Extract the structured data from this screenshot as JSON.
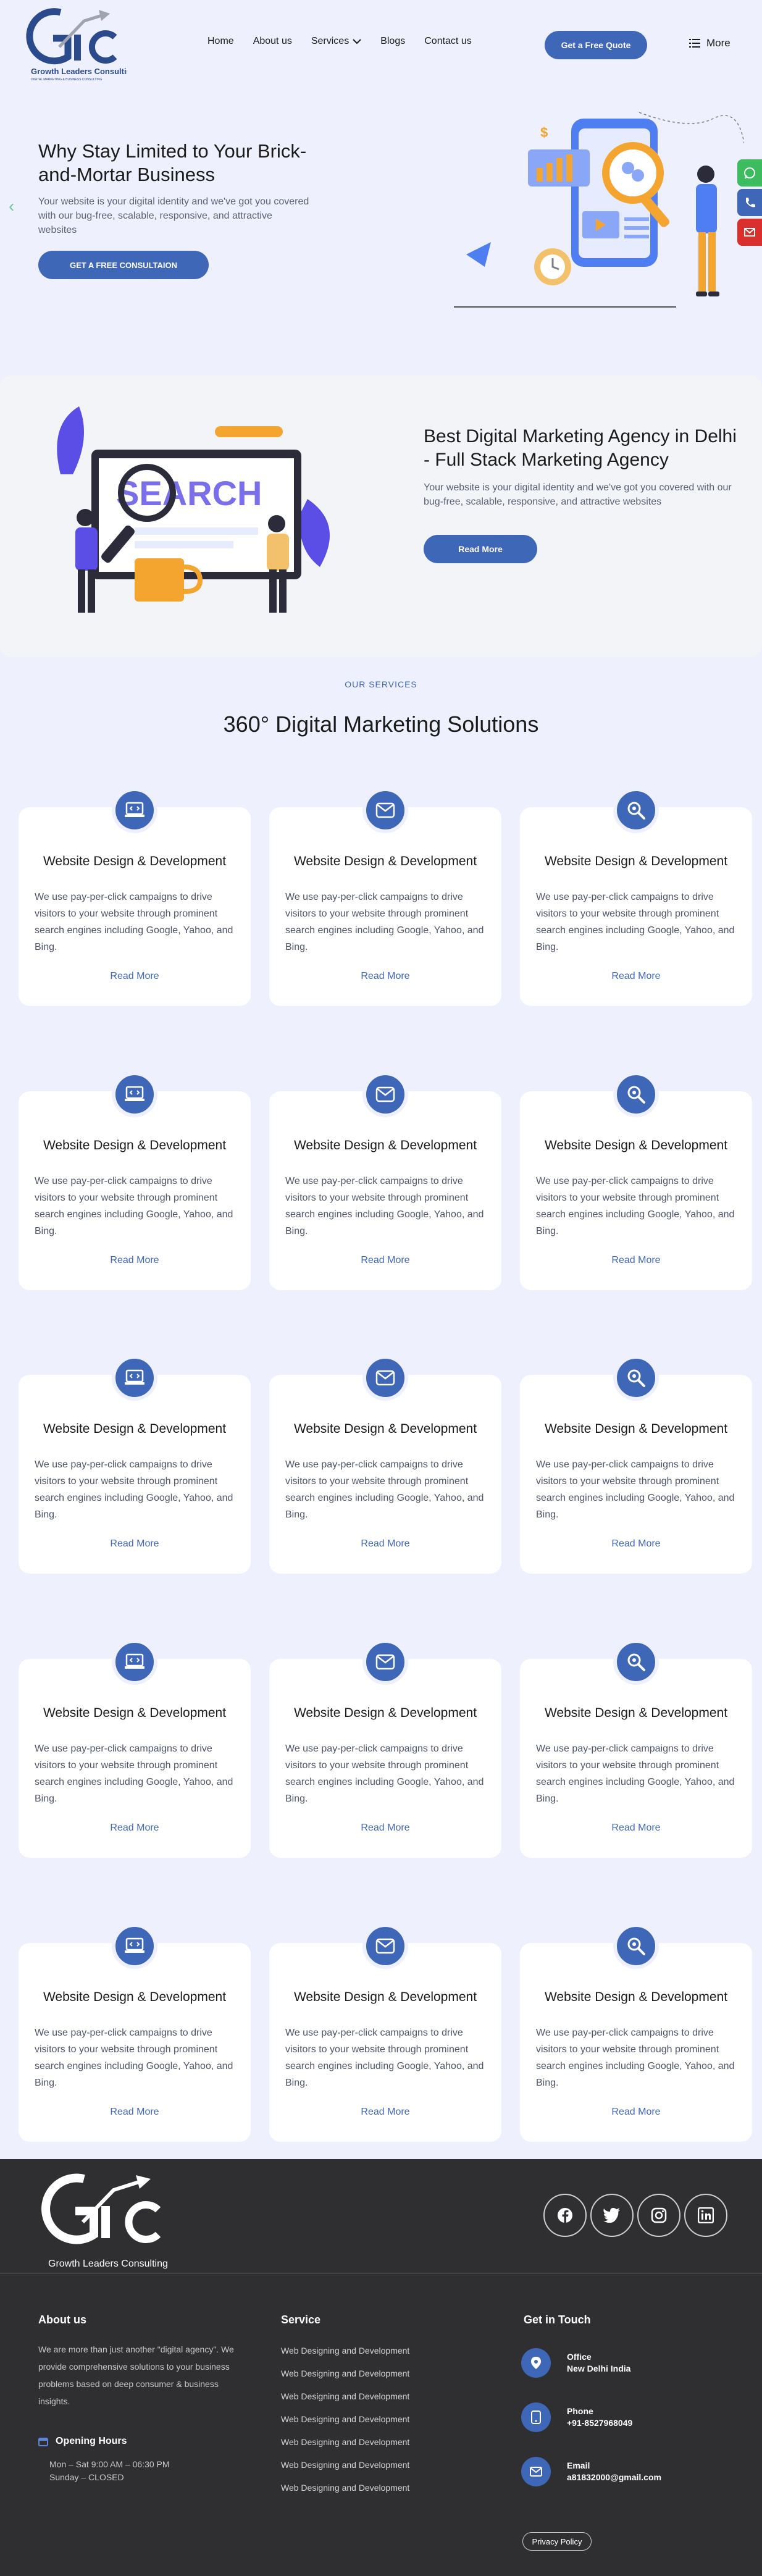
{
  "brand": {
    "logo_text": "Growth Leaders Consulting",
    "logo_tagline": "DIGITAL MARKETING & BUSINESS CONSULTING"
  },
  "nav": {
    "items": [
      {
        "label": "Home"
      },
      {
        "label": "About us"
      },
      {
        "label": "Services"
      },
      {
        "label": "Blogs"
      },
      {
        "label": "Contact us"
      }
    ],
    "quote_button": "Get a Free Quote",
    "more_label": "More"
  },
  "hero": {
    "title": "Why Stay Limited to Your Brick-and-Mortar Business",
    "text": "Your website is your digital identity and we've got you covered with our bug-free, scalable, responsive, and attractive websites",
    "button": "GET A FREE CONSULTAION"
  },
  "agency": {
    "title": "Best Digital Marketing Agency in Delhi - Full Stack Marketing Agency",
    "text": "Your website is your digital identity and we've got you covered with our bug-free, scalable, responsive, and attractive websites",
    "button": "Read More",
    "art_word": "SEARCH"
  },
  "services": {
    "eyebrow": "OUR SERVICES",
    "title": "360° Digital Marketing Solutions",
    "cards": [
      {
        "icon": "laptop-code-icon",
        "title": "Website Design & Development",
        "text": "We use pay-per-click campaigns to drive visitors to your website through prominent search engines including Google, Yahoo, and Bing.",
        "link": "Read More"
      },
      {
        "icon": "envelope-icon",
        "title": "Website Design & Development",
        "text": "We use pay-per-click campaigns to drive visitors to your website through prominent search engines including Google, Yahoo, and Bing.",
        "link": "Read More"
      },
      {
        "icon": "search-icon",
        "title": "Website Design & Development",
        "text": "We use pay-per-click campaigns to drive visitors to your website through prominent search engines including Google, Yahoo, and Bing.",
        "link": "Read More"
      },
      {
        "icon": "laptop-code-icon",
        "title": "Website Design & Development",
        "text": "We use pay-per-click campaigns to drive visitors to your website through prominent search engines including Google, Yahoo, and Bing.",
        "link": "Read More"
      },
      {
        "icon": "envelope-icon",
        "title": "Website Design & Development",
        "text": "We use pay-per-click campaigns to drive visitors to your website through prominent search engines including Google, Yahoo, and Bing.",
        "link": "Read More"
      },
      {
        "icon": "search-icon",
        "title": "Website Design & Development",
        "text": "We use pay-per-click campaigns to drive visitors to your website through prominent search engines including Google, Yahoo, and Bing.",
        "link": "Read More"
      },
      {
        "icon": "laptop-code-icon",
        "title": "Website Design & Development",
        "text": "We use pay-per-click campaigns to drive visitors to your website through prominent search engines including Google, Yahoo, and Bing.",
        "link": "Read More"
      },
      {
        "icon": "envelope-icon",
        "title": "Website Design & Development",
        "text": "We use pay-per-click campaigns to drive visitors to your website through prominent search engines including Google, Yahoo, and Bing.",
        "link": "Read More"
      },
      {
        "icon": "search-icon",
        "title": "Website Design & Development",
        "text": "We use pay-per-click campaigns to drive visitors to your website through prominent search engines including Google, Yahoo, and Bing.",
        "link": "Read More"
      },
      {
        "icon": "laptop-code-icon",
        "title": "Website Design & Development",
        "text": "We use pay-per-click campaigns to drive visitors to your website through prominent search engines including Google, Yahoo, and Bing.",
        "link": "Read More"
      },
      {
        "icon": "envelope-icon",
        "title": "Website Design & Development",
        "text": "We use pay-per-click campaigns to drive visitors to your website through prominent search engines including Google, Yahoo, and Bing.",
        "link": "Read More"
      },
      {
        "icon": "search-icon",
        "title": "Website Design & Development",
        "text": "We use pay-per-click campaigns to drive visitors to your website through prominent search engines including Google, Yahoo, and Bing.",
        "link": "Read More"
      },
      {
        "icon": "laptop-code-icon",
        "title": "Website Design & Development",
        "text": "We use pay-per-click campaigns to drive visitors to your website through prominent search engines including Google, Yahoo, and Bing.",
        "link": "Read More"
      },
      {
        "icon": "envelope-icon",
        "title": "Website Design & Development",
        "text": "We use pay-per-click campaigns to drive visitors to your website through prominent search engines including Google, Yahoo, and Bing.",
        "link": "Read More"
      },
      {
        "icon": "search-icon",
        "title": "Website Design & Development",
        "text": "We use pay-per-click campaigns to drive visitors to your website through prominent search engines including Google, Yahoo, and Bing.",
        "link": "Read More"
      }
    ]
  },
  "footer": {
    "logo_text": "Growth Leaders Consulting",
    "social": [
      "facebook-icon",
      "twitter-icon",
      "instagram-icon",
      "linkedin-icon"
    ],
    "about_title": "About us",
    "about_text": "We are more than just another \"digital agency\". We provide comprehensive solutions to your business problems based on deep consumer & business insights.",
    "hours_title": "Opening Hours",
    "hours_line1": "Mon – Sat 9:00 AM – 06:30 PM",
    "hours_line2": "Sunday – CLOSED",
    "service_title": "Service",
    "service_items": [
      "Web Designing and Development",
      "Web Designing and Development",
      "Web Designing and Development",
      "Web Designing and Development",
      "Web Designing and Development",
      "Web Designing and Development",
      "Web Designing and Development"
    ],
    "contact_title": "Get in Touch",
    "contacts": [
      {
        "icon": "location-pin-icon",
        "label": "Office",
        "value": "New Delhi India"
      },
      {
        "icon": "phone-icon",
        "label": "Phone",
        "value": "+91-8527968049"
      },
      {
        "icon": "email-icon",
        "label": "Email",
        "value": "a81832000@gmail.com"
      }
    ],
    "privacy": "Privacy Policy"
  },
  "colors": {
    "accent": "#3f67b8",
    "background": "#eef0fd",
    "footer": "#2f2f31",
    "whatsapp": "#3dbb5f",
    "phone": "#3f67b8",
    "mail": "#d9302e"
  }
}
